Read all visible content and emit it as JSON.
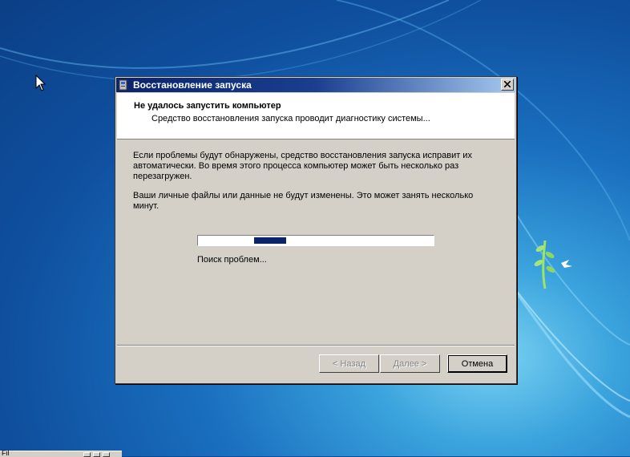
{
  "window": {
    "title": "Восстановление запуска",
    "close_label": "×"
  },
  "header": {
    "title": "Не удалось запустить компьютер",
    "subtitle": "Средство восстановления запуска проводит диагностику системы..."
  },
  "body": {
    "paragraph1": "Если проблемы будут обнаружены, средство восстановления запуска исправит их автоматически. Во время этого процесса компьютер может быть несколько раз перезагружен.",
    "paragraph2": "Ваши личные файлы или данные не будут изменены. Это может занять несколько минут."
  },
  "progress": {
    "mode": "indeterminate",
    "status": "Поиск проблем..."
  },
  "buttons": {
    "back": "< Назад",
    "next": "Далее >",
    "cancel": "Отмена"
  },
  "taskbar": {
    "item_text": "Fil"
  },
  "colors": {
    "titlebar_start": "#0a246a",
    "titlebar_end": "#a6caf0",
    "dialog_face": "#d4d0c8",
    "progress_fill": "#0a246a",
    "desktop": "#1a6fbf"
  },
  "icons": [
    "startup-repair-icon",
    "close-icon",
    "mouse-cursor-icon",
    "windows-logo-icon"
  ]
}
